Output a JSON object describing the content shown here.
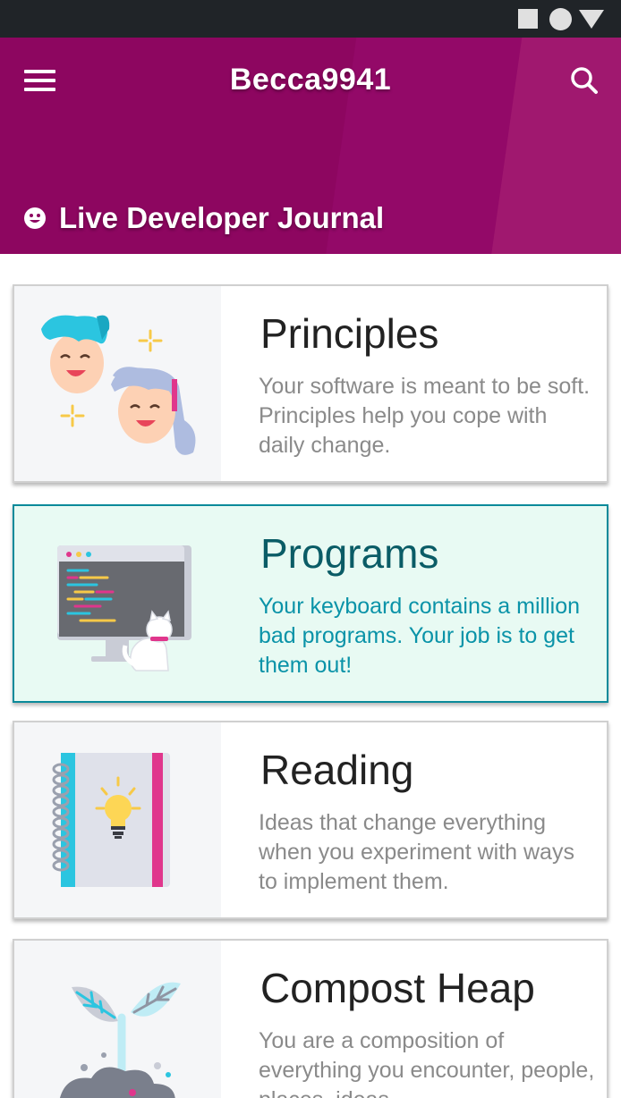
{
  "app": {
    "title": "Becca9941"
  },
  "header": {
    "journal_title": "Live Developer Journal"
  },
  "colors": {
    "header_bg": "#8d0660",
    "accent_teal": "#0a93a8"
  },
  "icons": {
    "menu": "hamburger-menu-icon",
    "search": "search-icon",
    "journal": "smiley-icon"
  },
  "cards": [
    {
      "title": "Principles",
      "description": "Your software is meant to be soft. Principles help you cope with daily change.",
      "icon": "two-faces-illustration"
    },
    {
      "title": "Programs",
      "description": "Your keyboard contains a million bad programs. Your job is to get them out!",
      "icon": "computer-cat-illustration",
      "selected": true
    },
    {
      "title": "Reading",
      "description": "Ideas that change everything when you experiment with ways to implement them.",
      "icon": "notebook-lightbulb-illustration"
    },
    {
      "title": "Compost Heap",
      "description": "You are a composition of everything you encounter, people, places, ideas.",
      "icon": "sprout-illustration"
    }
  ]
}
